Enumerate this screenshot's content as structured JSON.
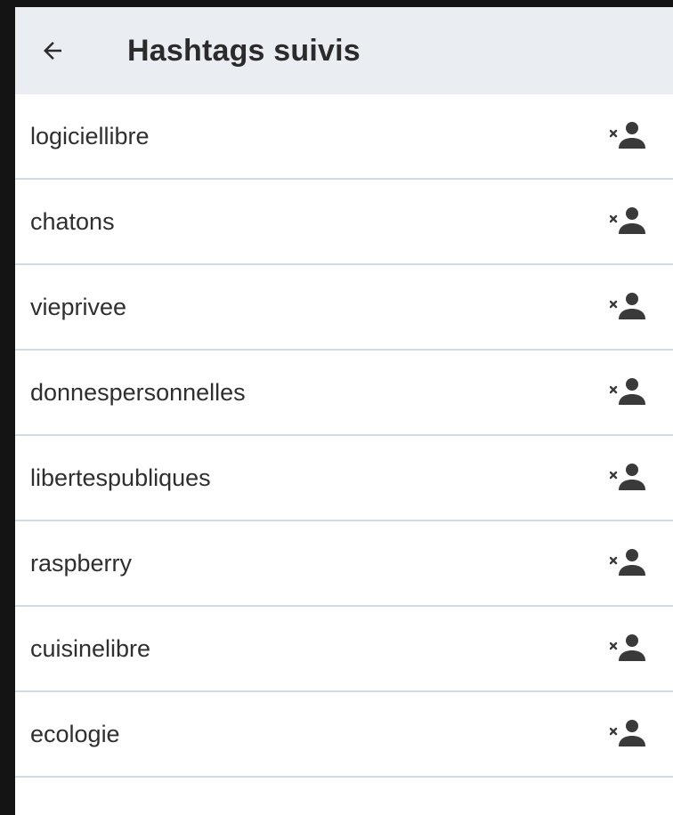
{
  "appbar": {
    "back_icon": "arrow-left-icon",
    "title": "Hashtags suivis"
  },
  "hashtags": [
    {
      "name": "logiciellibre",
      "action_icon": "remove-person-icon"
    },
    {
      "name": "chatons",
      "action_icon": "remove-person-icon"
    },
    {
      "name": "vieprivee",
      "action_icon": "remove-person-icon"
    },
    {
      "name": "donnespersonnelles",
      "action_icon": "remove-person-icon"
    },
    {
      "name": "libertespubliques",
      "action_icon": "remove-person-icon"
    },
    {
      "name": "raspberry",
      "action_icon": "remove-person-icon"
    },
    {
      "name": "cuisinelibre",
      "action_icon": "remove-person-icon"
    },
    {
      "name": "ecologie",
      "action_icon": "remove-person-icon"
    }
  ],
  "colors": {
    "appbar_bg": "#eaedf2",
    "divider": "#cfdbe6",
    "text": "#2f2f2f",
    "icon": "#3a3a3a"
  }
}
